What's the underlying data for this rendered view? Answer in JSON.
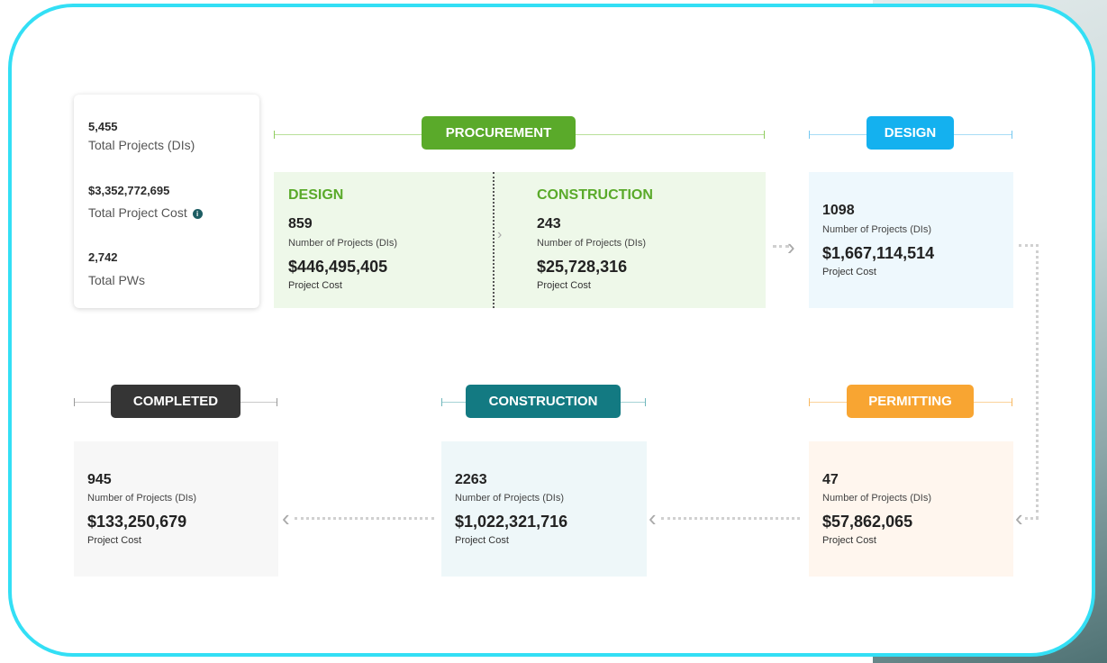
{
  "summary": {
    "total_projects_value": "5,455",
    "total_projects_label": "Total Projects (DIs)",
    "total_cost_value": "$3,352,772,695",
    "total_cost_label": "Total Project Cost",
    "info_icon": "i",
    "total_pws_value": "2,742",
    "total_pws_label": "Total PWs"
  },
  "procurement": {
    "badge": "PROCUREMENT",
    "design": {
      "heading": "DESIGN",
      "count": "859",
      "count_label": "Number of Projects (DIs)",
      "cost": "$446,495,405",
      "cost_label": "Project Cost"
    },
    "construction": {
      "heading": "CONSTRUCTION",
      "count": "243",
      "count_label": "Number of Projects (DIs)",
      "cost": "$25,728,316",
      "cost_label": "Project Cost"
    }
  },
  "design": {
    "badge": "DESIGN",
    "count": "1098",
    "count_label": "Number of Projects (DIs)",
    "cost": "$1,667,114,514",
    "cost_label": "Project Cost"
  },
  "permitting": {
    "badge": "PERMITTING",
    "count": "47",
    "count_label": "Number of Projects (DIs)",
    "cost": "$57,862,065",
    "cost_label": "Project Cost"
  },
  "construction": {
    "badge": "CONSTRUCTION",
    "count": "2263",
    "count_label": "Number of Projects (DIs)",
    "cost": "$1,022,321,716",
    "cost_label": "Project Cost"
  },
  "completed": {
    "badge": "COMPLETED",
    "count": "945",
    "count_label": "Number of Projects (DIs)",
    "cost": "$133,250,679",
    "cost_label": "Project Cost"
  },
  "colors": {
    "procurement": "#5aaa2a",
    "design": "#14b1ef",
    "permitting": "#f8a532",
    "construction": "#137a82",
    "completed": "#353535",
    "frame": "#33dff5"
  },
  "icons": {
    "arrow_right": "›",
    "arrow_left": "‹"
  }
}
